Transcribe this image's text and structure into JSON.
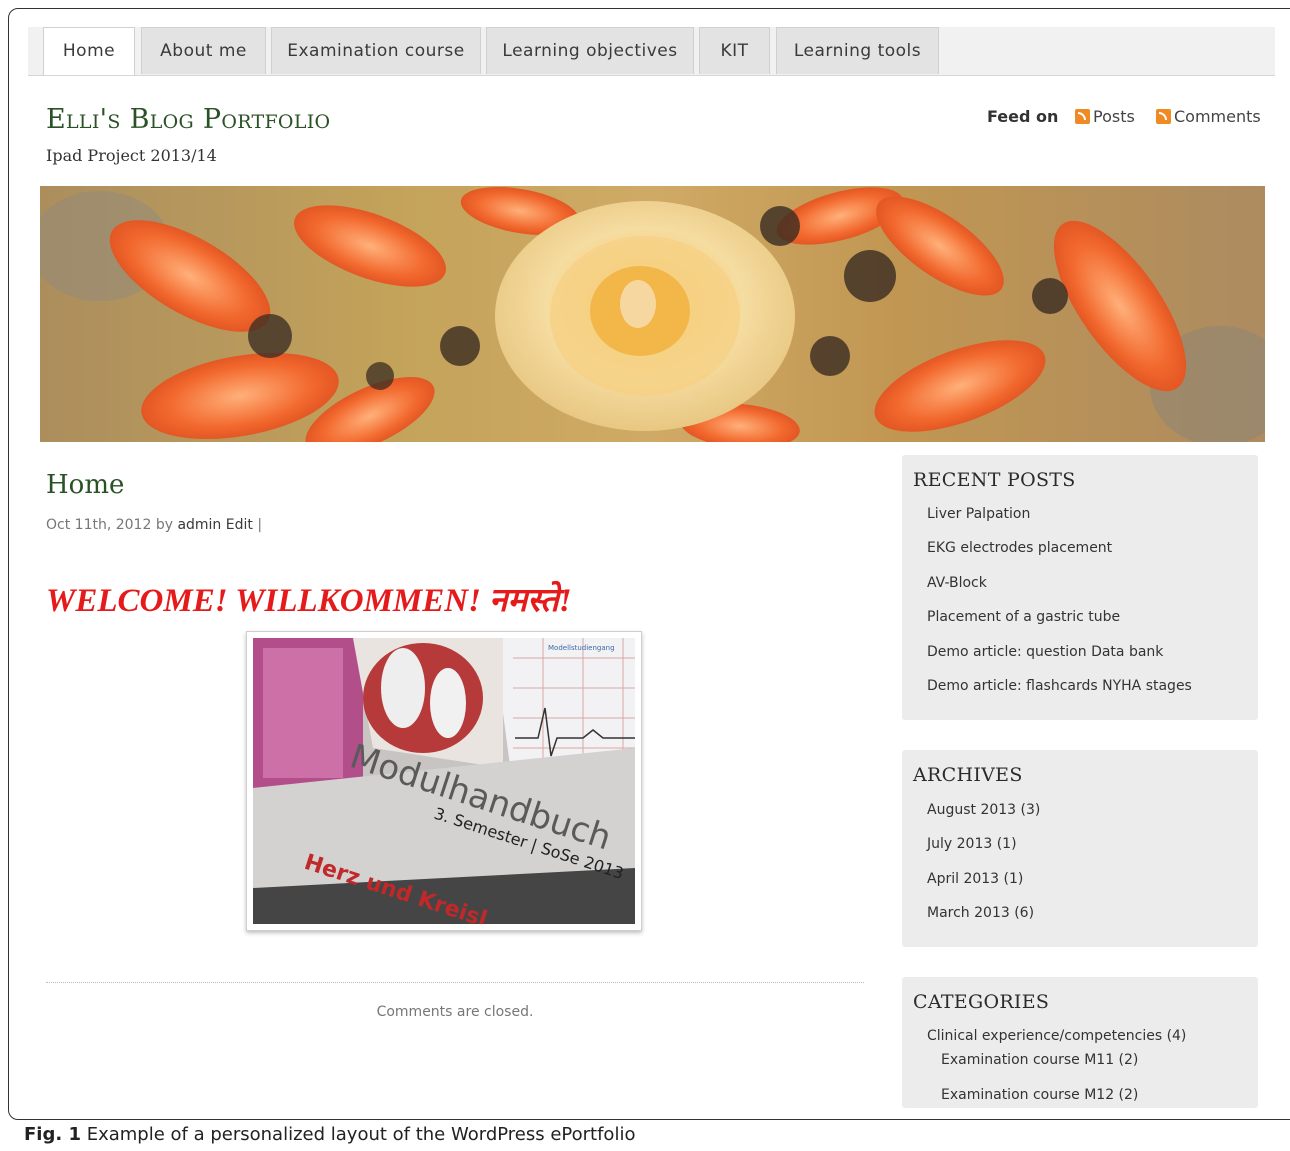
{
  "nav": {
    "tabs": [
      "Home",
      "About me",
      "Examination course",
      "Learning objectives",
      "KIT",
      "Learning tools"
    ]
  },
  "header": {
    "title": "Elli's Blog Portfolio",
    "subtitle": "Ipad Project 2013/14",
    "feed_label": "Feed on",
    "feed_posts": "Posts",
    "feed_comments": "Comments"
  },
  "main": {
    "heading": "Home",
    "meta_date": "Oct 11th, 2012 by",
    "meta_author": "admin",
    "meta_edit": "Edit",
    "meta_sep": "|",
    "welcome": "WELCOME! WILLKOMMEN! नमस्ते!",
    "photo_text": {
      "line1": "Modulhandbuch",
      "line2": "3. Semester | SoSe 2013",
      "line3": "Herz und Kreisl",
      "corner": "Modellstudiengang"
    },
    "comments_closed": "Comments are closed."
  },
  "sidebar": {
    "recent_posts": {
      "title": "RECENT POSTS",
      "items": [
        "Liver Palpation",
        "EKG electrodes placement",
        "AV-Block",
        "Placement of a gastric tube",
        "Demo article: question Data bank",
        "Demo article: flashcards NYHA stages"
      ]
    },
    "archives": {
      "title": "ARCHIVES",
      "items": [
        "August 2013 (3)",
        "July 2013 (1)",
        "April 2013 (1)",
        "March 2013 (6)"
      ]
    },
    "categories": {
      "title": "CATEGORIES",
      "items": [
        "Clinical experience/competencies (4)",
        "Examination course M11 (2)",
        "Examination course M12 (2)"
      ]
    }
  },
  "caption": {
    "label": "Fig. 1",
    "text": "Example of a personalized layout of the WordPress ePortfolio"
  },
  "colors": {
    "title_green": "#2a5226",
    "welcome_red": "#e51b1b",
    "rss_orange": "#f08a24",
    "widget_bg": "#ececec"
  }
}
